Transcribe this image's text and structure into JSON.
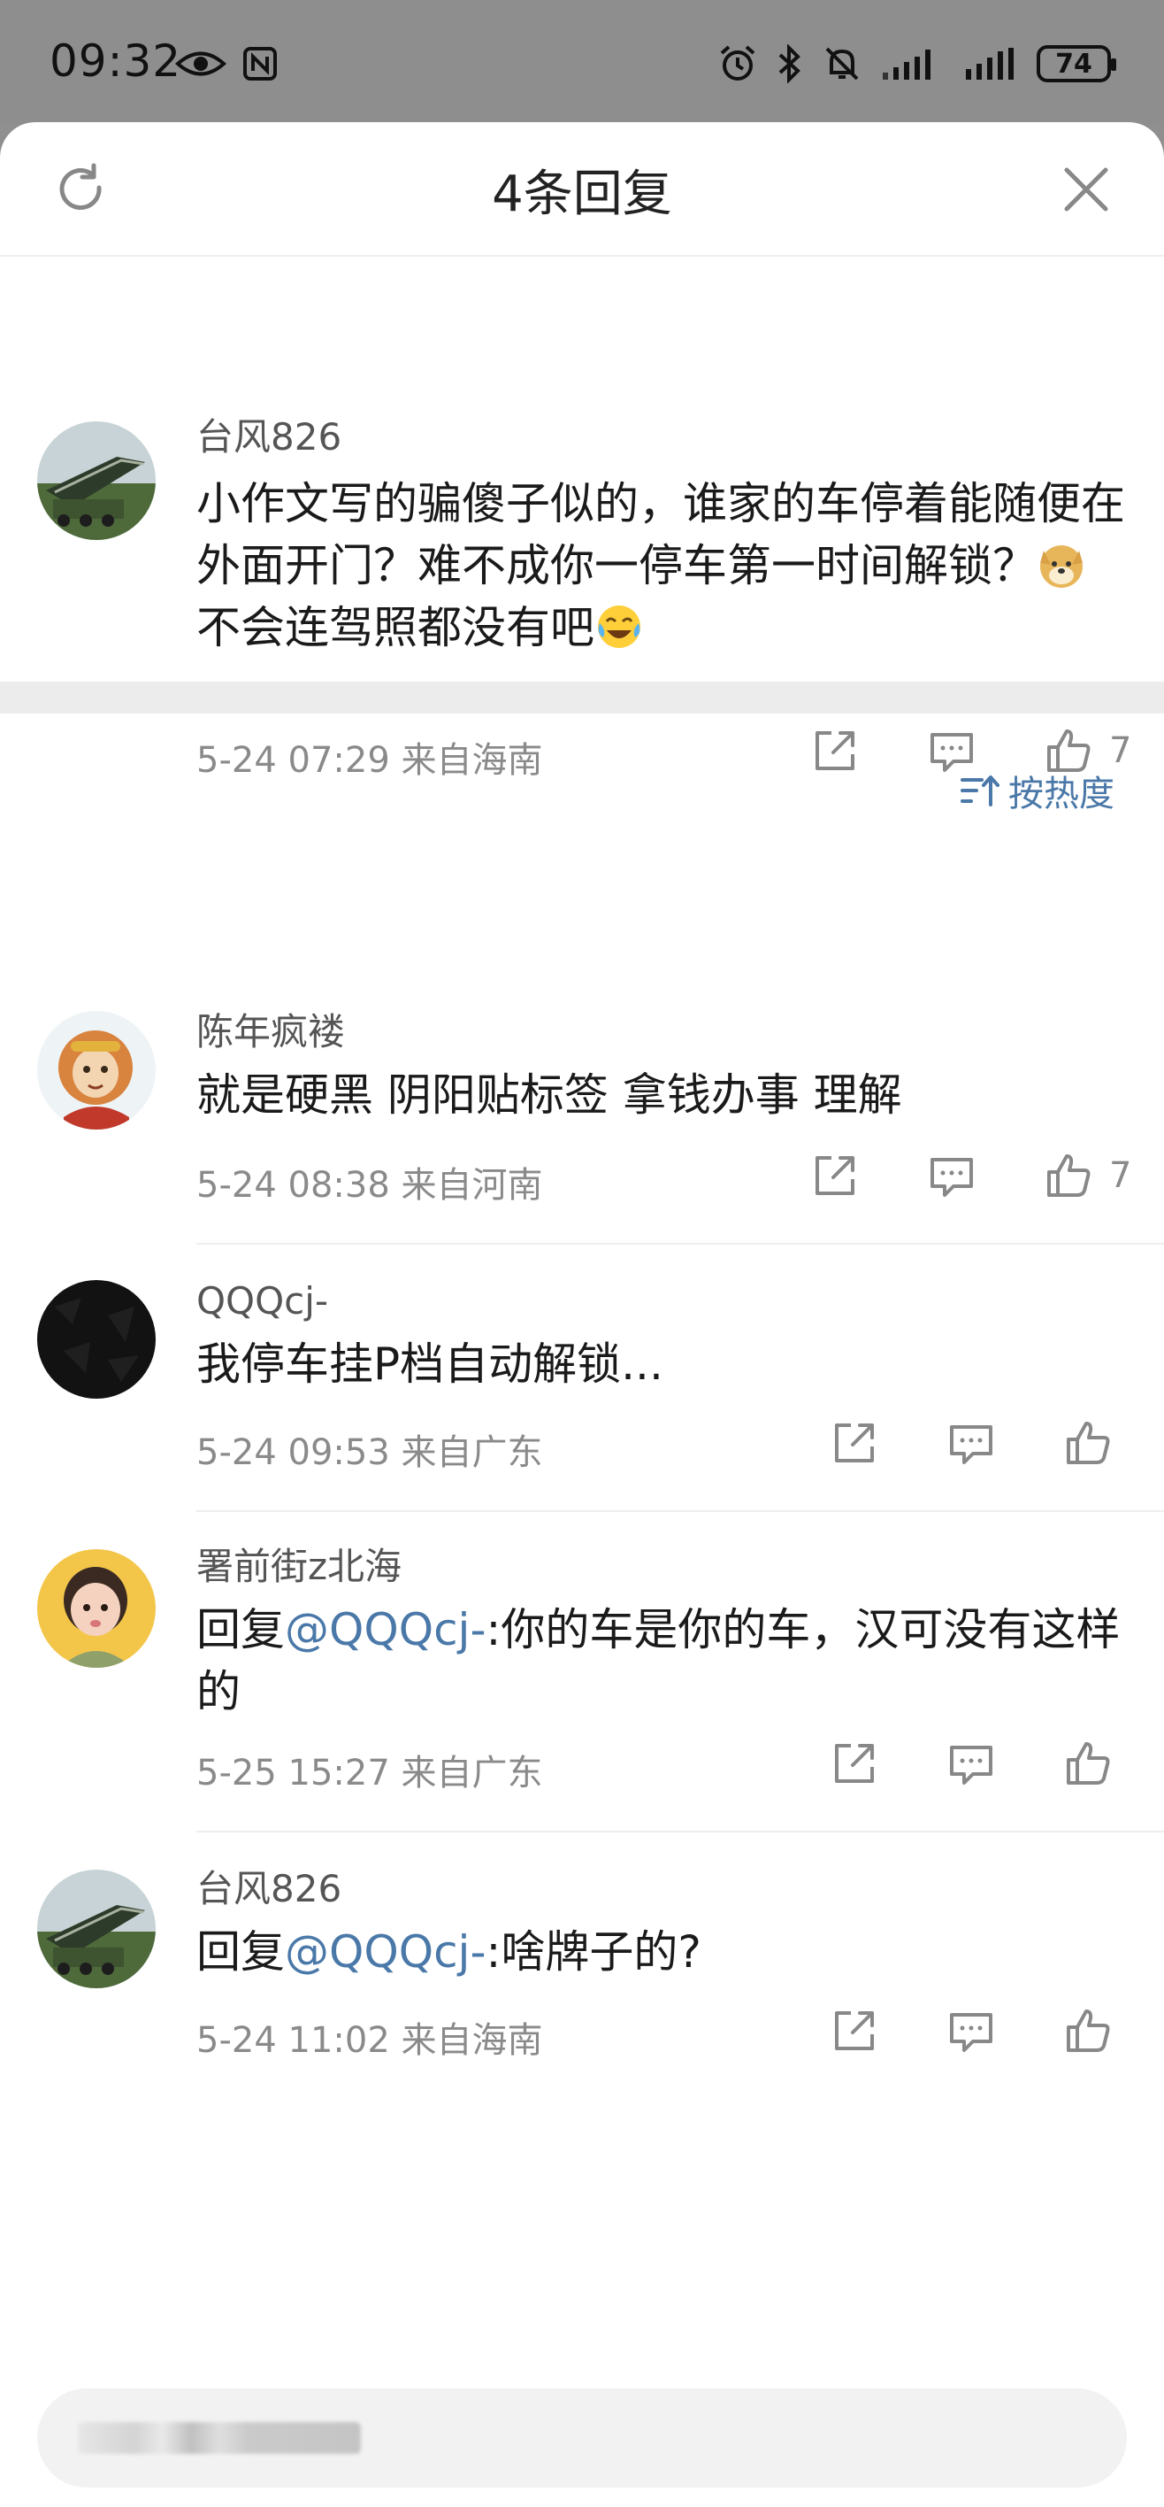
{
  "status_bar": {
    "time": "09:32",
    "battery": "74"
  },
  "sheet": {
    "title": "4条回复",
    "refresh_icon": "refresh-icon",
    "close_icon": "close-icon"
  },
  "root_comment": {
    "username": "台风826",
    "text_part1": "小作文写的骗傻子似的，谁家的车停着能随便在外面开门？难不成你一停车第一时间解锁？",
    "emoji1": "doge-emoji",
    "text_part2": "不会连驾照都没有吧",
    "emoji2": "laugh-cry-emoji",
    "meta": "5-24 07:29 来自海南",
    "like_count": "7"
  },
  "sort": {
    "label": "按热度",
    "icon": "sort-icon"
  },
  "replies": [
    {
      "username": "陈年疯褛",
      "text": "就是硬黑 阴阳贴标签  拿钱办事 理解",
      "meta": "5-24 08:38 来自河南",
      "like_count": "7"
    },
    {
      "username": "QQQcj-",
      "text": "我停车挂P档自动解锁...",
      "meta": "5-24 09:53 来自广东",
      "like_count": ""
    },
    {
      "username": "署前街z北海",
      "reply_prefix": "回复",
      "mention": "@QQQcj-",
      "text": ":你的车是你的车，汉可没有这样的",
      "meta": "5-25 15:27 来自广东",
      "like_count": ""
    },
    {
      "username": "台风826",
      "reply_prefix": "回复",
      "mention": "@QQQcj-",
      "text": ":啥牌子的?",
      "meta": "5-24 11:02 来自海南",
      "like_count": ""
    }
  ],
  "icons": {
    "share": "share-icon",
    "comment": "comment-icon",
    "like": "thumbs-up-icon"
  },
  "colors": {
    "link": "#4a78a8",
    "meta": "#8a8a8a",
    "status_bar_bg": "#8e8e8e"
  }
}
